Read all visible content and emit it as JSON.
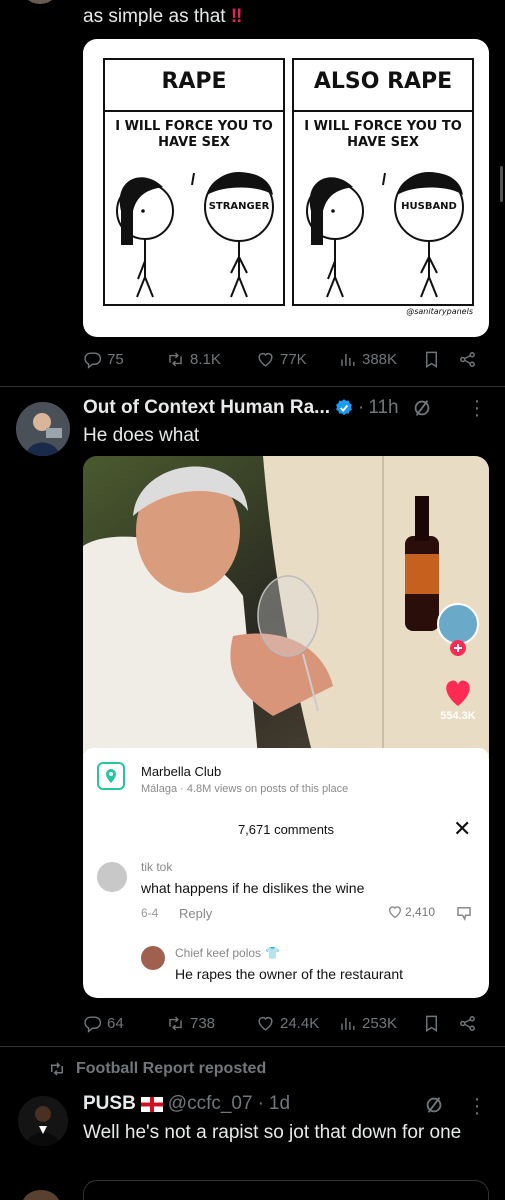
{
  "tweet1": {
    "text_line": "as simple as that",
    "emoji": "‼️",
    "comic": {
      "left": {
        "title": "RAPE",
        "caption": "I WILL FORCE YOU TO HAVE SEX",
        "tag": "STRANGER"
      },
      "right": {
        "title": "ALSO RAPE",
        "caption": "I WILL FORCE YOU TO HAVE SEX",
        "tag": "HUSBAND"
      },
      "credit": "@sanitarypanels"
    },
    "actions": {
      "replies": "75",
      "reposts": "8.1K",
      "likes": "77K",
      "views": "388K"
    }
  },
  "tweet2": {
    "display_name": "Out of Context Human Ra...",
    "time": "11h",
    "separator": "·",
    "text": "He does what",
    "video": {
      "like_count": "554.3K",
      "location_name": "Marbella Club",
      "location_sub": "Málaga · 4.8M views on posts of this place",
      "comments_header": "7,671 comments",
      "comment1": {
        "user": "tik tok",
        "text": "what happens if he dislikes the wine",
        "date": "6-4",
        "reply": "Reply",
        "likes": "2,410"
      },
      "comment2": {
        "user": "Chief keef polos",
        "text": "He rapes the owner of the restaurant"
      }
    },
    "actions": {
      "replies": "64",
      "reposts": "738",
      "likes": "24.4K",
      "views": "253K"
    }
  },
  "tweet3": {
    "reposted_by": "Football Report reposted",
    "display_name": "PUSB",
    "handle": "@ccfc_07",
    "time": "1d",
    "separator": "·",
    "text": "Well he's not a rapist so jot that down for one"
  },
  "colors": {
    "bg": "#000000",
    "text": "#e7e9ea",
    "muted": "#71767b",
    "verified": "#1d9bf0",
    "divider": "#2f3336"
  }
}
